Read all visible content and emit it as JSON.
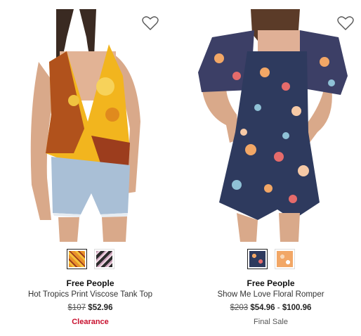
{
  "products": [
    {
      "brand": "Free People",
      "name": "Hot Tropics Print Viscose Tank Top",
      "original_price": "$107",
      "sale_price": "$52.96",
      "tag": "Clearance",
      "swatches": [
        {
          "color": "#e8912a",
          "selected": true
        },
        {
          "color": "#2b2b2b",
          "selected": false
        }
      ]
    },
    {
      "brand": "Free People",
      "name": "Show Me Love Floral Romper",
      "original_price": "$203",
      "sale_price_low": "$54.96",
      "sale_price_high": "$100.96",
      "price_separator": "-",
      "tag": "Final Sale",
      "swatches": [
        {
          "color": "#2e3a5e",
          "selected": true
        },
        {
          "color": "#f2a766",
          "selected": false
        }
      ]
    }
  ],
  "icons": {
    "favorite": "heart-outline-icon"
  }
}
